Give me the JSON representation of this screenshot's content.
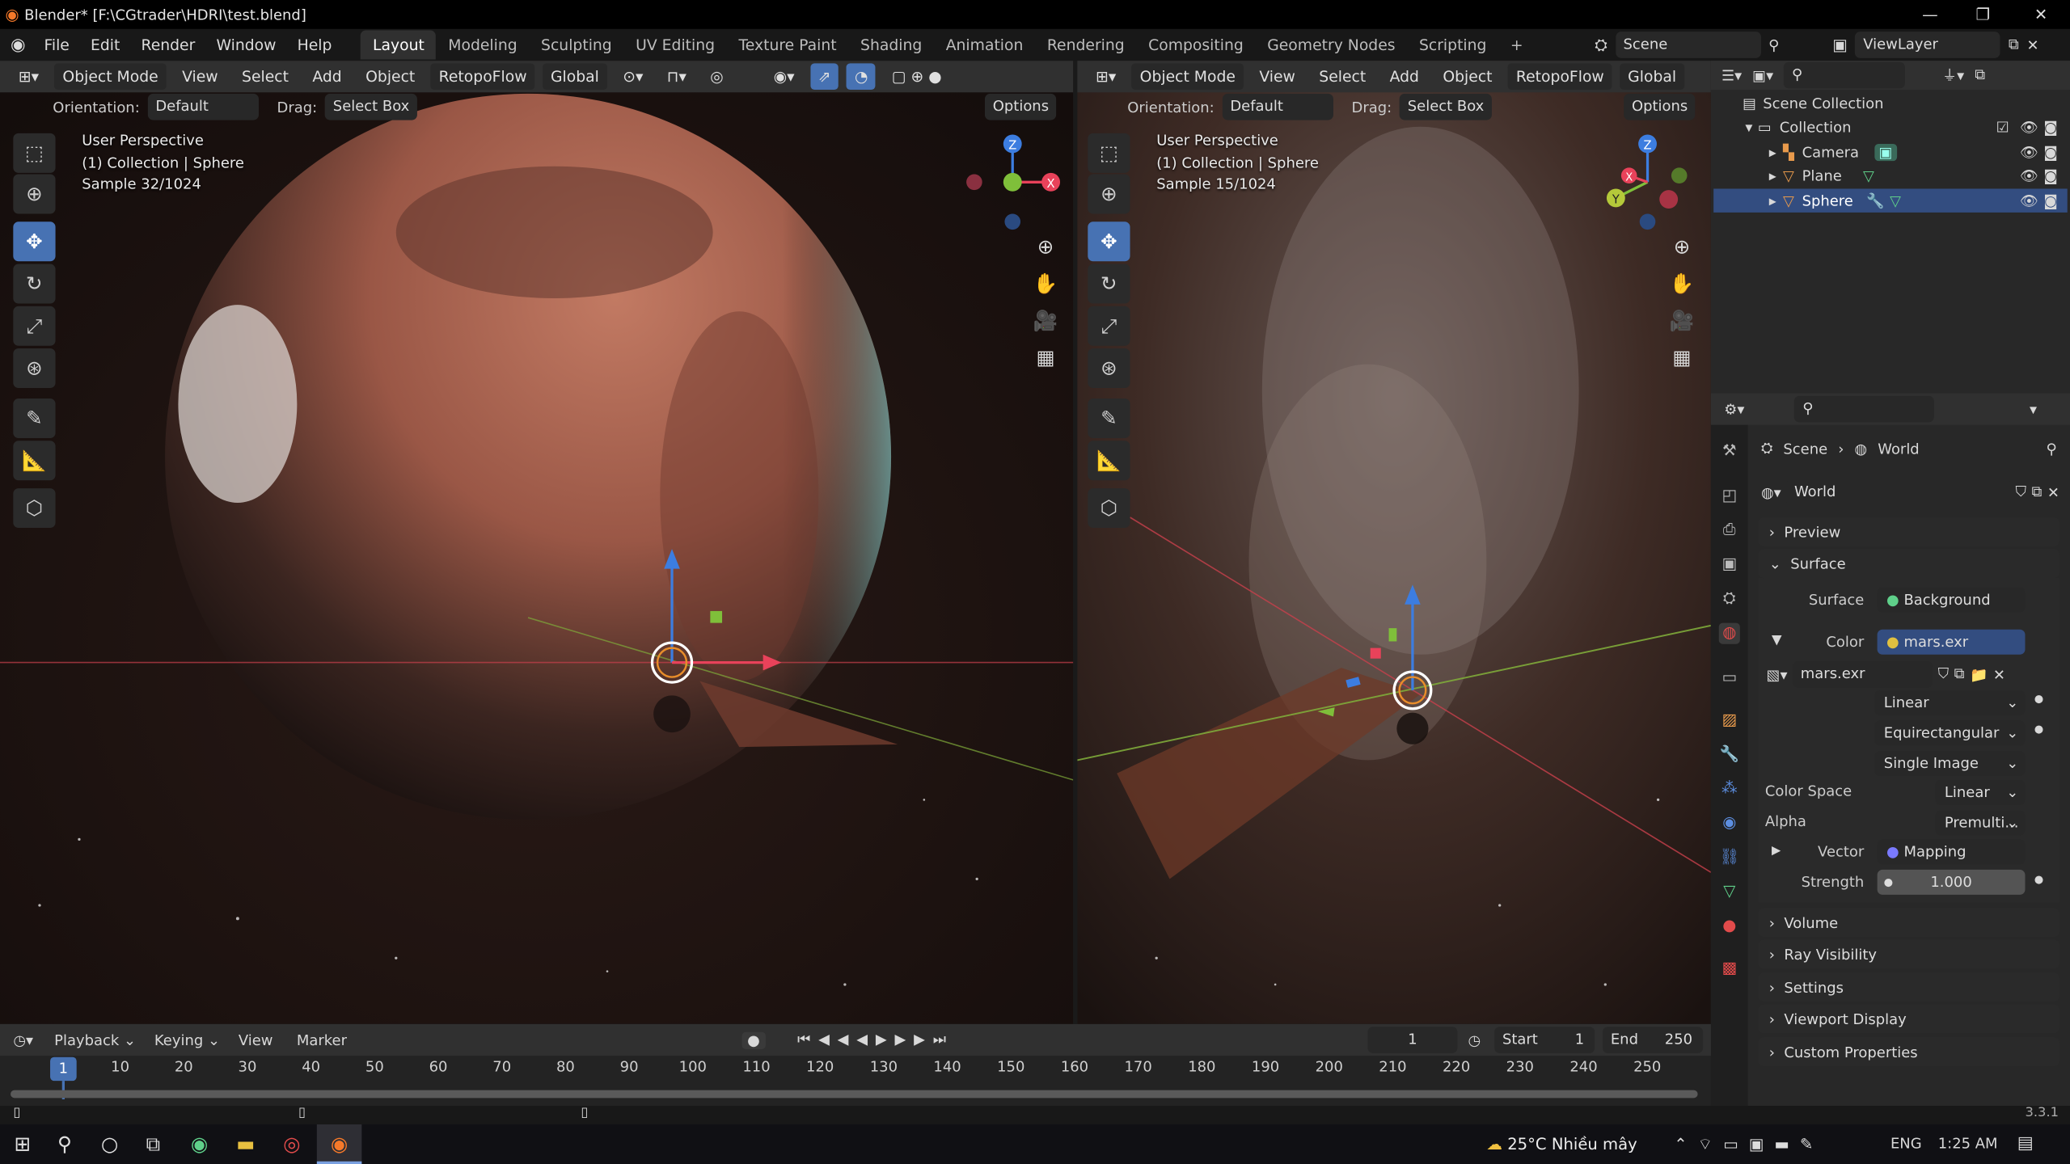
{
  "title_bar": {
    "text": "Blender* [F:\\CGtrader\\HDRI\\test.blend]",
    "minimize": "—",
    "restore": "❐",
    "close": "✕"
  },
  "menu": {
    "items": [
      "File",
      "Edit",
      "Render",
      "Window",
      "Help"
    ]
  },
  "workspaces": [
    "Layout",
    "Modeling",
    "Sculpting",
    "UV Editing",
    "Texture Paint",
    "Shading",
    "Animation",
    "Rendering",
    "Compositing",
    "Geometry Nodes",
    "Scripting",
    "+"
  ],
  "scene": {
    "label": "Scene",
    "viewlayer": "ViewLayer"
  },
  "viewport_header": {
    "mode": "Object Mode",
    "view": "View",
    "select": "Select",
    "add": "Add",
    "object": "Object",
    "addon": "RetopoFlow",
    "transform": "Global"
  },
  "tool_settings": {
    "orientation_label": "Orientation:",
    "orientation": "Default",
    "drag_label": "Drag:",
    "drag": "Select Box",
    "options": "Options"
  },
  "viewport_left": {
    "line1": "User Perspective",
    "line2": "(1) Collection | Sphere",
    "line3": "Sample 32/1024"
  },
  "viewport_right": {
    "line1": "User Perspective",
    "line2": "(1) Collection | Sphere",
    "line3": "Sample 15/1024"
  },
  "gizmo": {
    "x": "X",
    "y": "Y",
    "z": "Z"
  },
  "outliner": {
    "root": "Scene Collection",
    "collection": "Collection",
    "items": [
      {
        "name": "Camera"
      },
      {
        "name": "Plane"
      },
      {
        "name": "Sphere"
      }
    ]
  },
  "properties": {
    "breadcrumb": [
      "Scene",
      "World"
    ],
    "world_name": "World",
    "sections": {
      "preview": "Preview",
      "surface": "Surface",
      "volume": "Volume",
      "ray_visibility": "Ray Visibility",
      "settings": "Settings",
      "viewport_display": "Viewport Display",
      "custom_properties": "Custom Properties"
    },
    "surface_label": "Surface",
    "surface_value": "Background",
    "color_label": "Color",
    "color_value": "mars.exr",
    "image_name": "mars.exr",
    "interpolation": "Linear",
    "projection": "Equirectangular",
    "source": "Single Image",
    "color_space_label": "Color Space",
    "color_space": "Linear",
    "alpha_label": "Alpha",
    "alpha": "Premulti...",
    "vector_label": "Vector",
    "vector": "Mapping",
    "strength_label": "Strength",
    "strength": "1.000"
  },
  "timeline": {
    "menu": [
      "Playback",
      "Keying",
      "View",
      "Marker"
    ],
    "current_frame": "1",
    "start_label": "Start",
    "start": "1",
    "end_label": "End",
    "end": "250",
    "ticks": [
      "1",
      "10",
      "20",
      "30",
      "40",
      "50",
      "60",
      "70",
      "80",
      "90",
      "100",
      "110",
      "120",
      "130",
      "140",
      "150",
      "160",
      "170",
      "180",
      "190",
      "200",
      "210",
      "220",
      "230",
      "240",
      "250"
    ]
  },
  "statusbar": {
    "version": "3.3.1"
  },
  "taskbar": {
    "weather": "25°C  Nhiều mây",
    "lang": "ENG",
    "time": "1:25 AM"
  },
  "colors": {
    "accent": "#4772b3",
    "x_axis": "#e8425a",
    "y_axis": "#7fbf3a",
    "z_axis": "#3c7de0",
    "select": "#334d80"
  }
}
